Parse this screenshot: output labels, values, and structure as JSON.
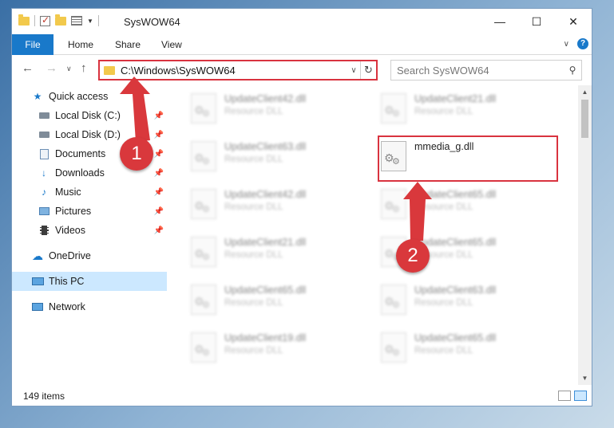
{
  "window": {
    "title": "SysWOW64"
  },
  "ribbon": {
    "tabs": [
      "File",
      "Home",
      "Share",
      "View"
    ],
    "help": "?"
  },
  "address": {
    "path": "C:\\Windows\\SysWOW64"
  },
  "search": {
    "placeholder": "Search SysWOW64"
  },
  "sidebar": {
    "items": [
      {
        "label": "Quick access",
        "icon": "star-icon",
        "pinned": false
      },
      {
        "label": "Local Disk (C:)",
        "icon": "drive-icon",
        "pinned": true
      },
      {
        "label": "Local Disk (D:)",
        "icon": "drive-icon",
        "pinned": true
      },
      {
        "label": "Documents",
        "icon": "documents-icon",
        "pinned": true
      },
      {
        "label": "Downloads",
        "icon": "download-icon",
        "pinned": true
      },
      {
        "label": "Music",
        "icon": "music-icon",
        "pinned": true
      },
      {
        "label": "Pictures",
        "icon": "pictures-icon",
        "pinned": true
      },
      {
        "label": "Videos",
        "icon": "videos-icon",
        "pinned": true
      },
      {
        "label": "OneDrive",
        "icon": "cloud-icon",
        "pinned": false
      },
      {
        "label": "This PC",
        "icon": "computer-icon",
        "pinned": false,
        "selected": true
      },
      {
        "label": "Network",
        "icon": "network-icon",
        "pinned": false
      }
    ]
  },
  "files": {
    "left": [
      {
        "name": "UpdateClient42.dll",
        "type": "Resource DLL"
      },
      {
        "name": "UpdateClient63.dll",
        "type": "Resource DLL"
      },
      {
        "name": "UpdateClient42.dll",
        "type": "Resource DLL"
      },
      {
        "name": "UpdateClient21.dll",
        "type": "Resource DLL"
      },
      {
        "name": "UpdateClient65.dll",
        "type": "Resource DLL"
      },
      {
        "name": "UpdateClient19.dll",
        "type": "Resource DLL"
      }
    ],
    "right": [
      {
        "name": "UpdateClient21.dll",
        "type": "Resource DLL"
      },
      {
        "name": "mmedia_g.dll",
        "type": "",
        "highlighted": true
      },
      {
        "name": "UpdateClient65.dll",
        "type": "Resource DLL"
      },
      {
        "name": "UpdateClient65.dll",
        "type": "Resource DLL"
      },
      {
        "name": "UpdateClient63.dll",
        "type": "Resource DLL"
      },
      {
        "name": "UpdateClient65.dll",
        "type": "Resource DLL"
      }
    ]
  },
  "status": {
    "item_count": "149 items"
  },
  "annotations": {
    "step1": "1",
    "step2": "2",
    "color": "#d9383c"
  }
}
